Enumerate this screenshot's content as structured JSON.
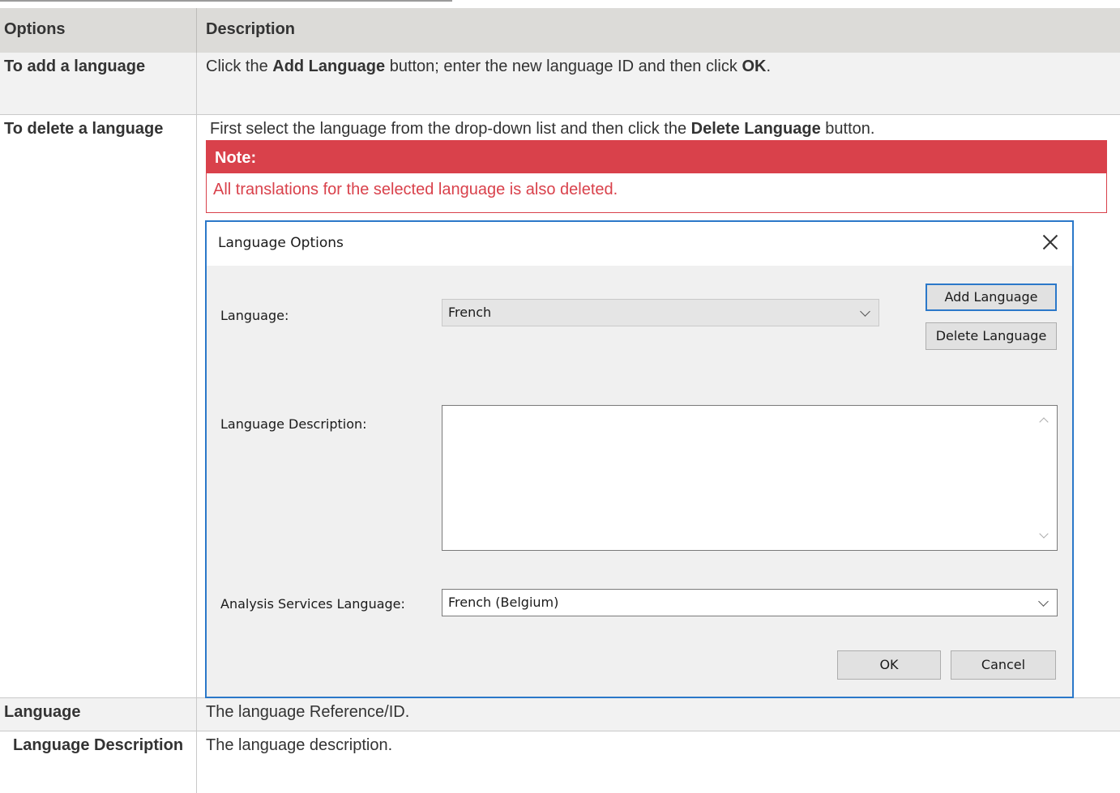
{
  "table": {
    "headers": [
      "Options",
      "Description"
    ],
    "rows": {
      "add": {
        "option": "To add a language",
        "desc_part1": "Click the ",
        "desc_bold1": "Add Language",
        "desc_part2": " button; enter the new language ID and then click ",
        "desc_bold2": "OK",
        "desc_part3": "."
      },
      "delete": {
        "option": "To delete a language",
        "desc_part1": "First select the language from the drop-down list and then click the ",
        "desc_bold1": "Delete Language",
        "desc_part2": " button."
      },
      "language": {
        "option": "Language",
        "desc": "The language Reference/ID."
      },
      "description": {
        "option": "Language Description",
        "desc": "The language description."
      }
    }
  },
  "note": {
    "heading": "Note:",
    "body": "All translations for the selected language is also deleted."
  },
  "dialog": {
    "title": "Language Options",
    "language_label": "Language:",
    "language_value": "French",
    "add_button": "Add Language",
    "delete_button": "Delete Language",
    "description_label": "Language Description:",
    "description_value": "",
    "analysis_label": "Analysis Services Language:",
    "analysis_value": "French (Belgium)",
    "ok_button": "OK",
    "cancel_button": "Cancel"
  },
  "colors": {
    "header_bg": "#dcdbd8",
    "alt_row_bg": "#f2f2f2",
    "note_red": "#d9414b",
    "dialog_accent": "#2b78c9"
  }
}
